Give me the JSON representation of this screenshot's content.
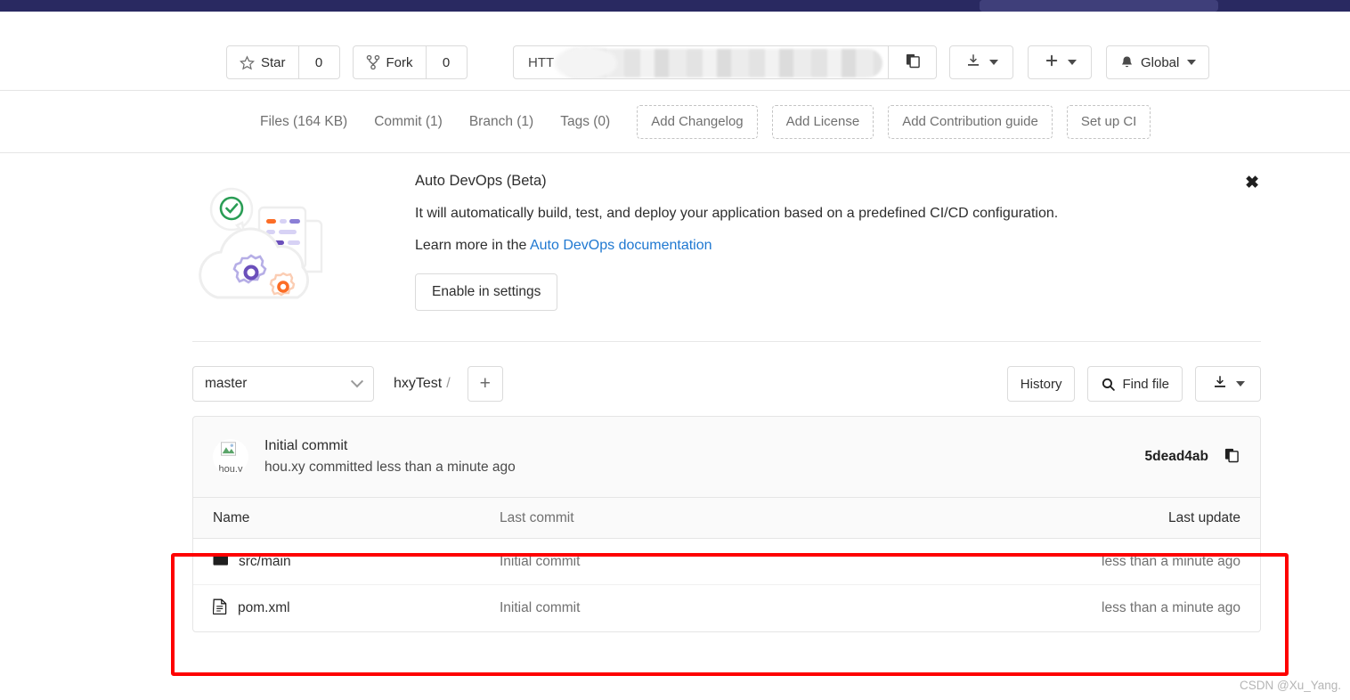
{
  "navbar": {
    "search_placeholder": ""
  },
  "action_bar": {
    "star_label": "Star",
    "star_count": "0",
    "fork_label": "Fork",
    "fork_count": "0",
    "clone_protocol": "HTT",
    "clone_url_masked": "",
    "copy_icon": "copy-icon",
    "download_icon": "download-icon",
    "plus_icon": "plus-icon",
    "notification_label": "Global",
    "bell_icon": "bell-icon"
  },
  "stats": {
    "links": [
      {
        "label": "Files (164 KB)"
      },
      {
        "label": "Commit (1)"
      },
      {
        "label": "Branch (1)"
      },
      {
        "label": "Tags (0)"
      }
    ],
    "quick_actions": [
      {
        "label": "Add Changelog"
      },
      {
        "label": "Add License"
      },
      {
        "label": "Add Contribution guide"
      },
      {
        "label": "Set up CI"
      }
    ]
  },
  "auto_devops": {
    "title": "Auto DevOps (Beta)",
    "description": "It will automatically build, test, and deploy your application based on a predefined CI/CD configuration.",
    "learn_prefix": "Learn more in the ",
    "learn_link": "Auto DevOps documentation",
    "enable_button": "Enable in settings",
    "close_icon": "close-icon",
    "illustration": "auto-devops-cloud-gears-illustration"
  },
  "branch_row": {
    "branch": "master",
    "breadcrumb_repo": "hxyTest",
    "breadcrumb_separator": "/",
    "add_button": "+",
    "history_label": "History",
    "find_file_label": "Find file",
    "search_icon": "search-icon",
    "download_icon": "download-icon"
  },
  "commit": {
    "title": "Initial commit",
    "author": "hou.xy",
    "meta": "hou.xy committed less than a minute ago",
    "avatar_alt": "hou.y",
    "sha": "5dead4ab",
    "copy_icon": "copy-icon"
  },
  "file_table": {
    "headers": {
      "name": "Name",
      "last_commit": "Last commit",
      "last_update": "Last update"
    },
    "rows": [
      {
        "type": "folder",
        "icon": "folder-icon",
        "name": "src/main",
        "last_commit": "Initial commit",
        "last_update": "less than a minute ago"
      },
      {
        "type": "file",
        "icon": "file-icon",
        "name": "pom.xml",
        "last_commit": "Initial commit",
        "last_update": "less than a minute ago"
      }
    ]
  },
  "watermark": {
    "text": "CSDN @Xu_Yang."
  },
  "colors": {
    "navbar": "#292961",
    "link": "#1f78d1",
    "annotation": "#fe0000",
    "muted_text": "#707070"
  }
}
